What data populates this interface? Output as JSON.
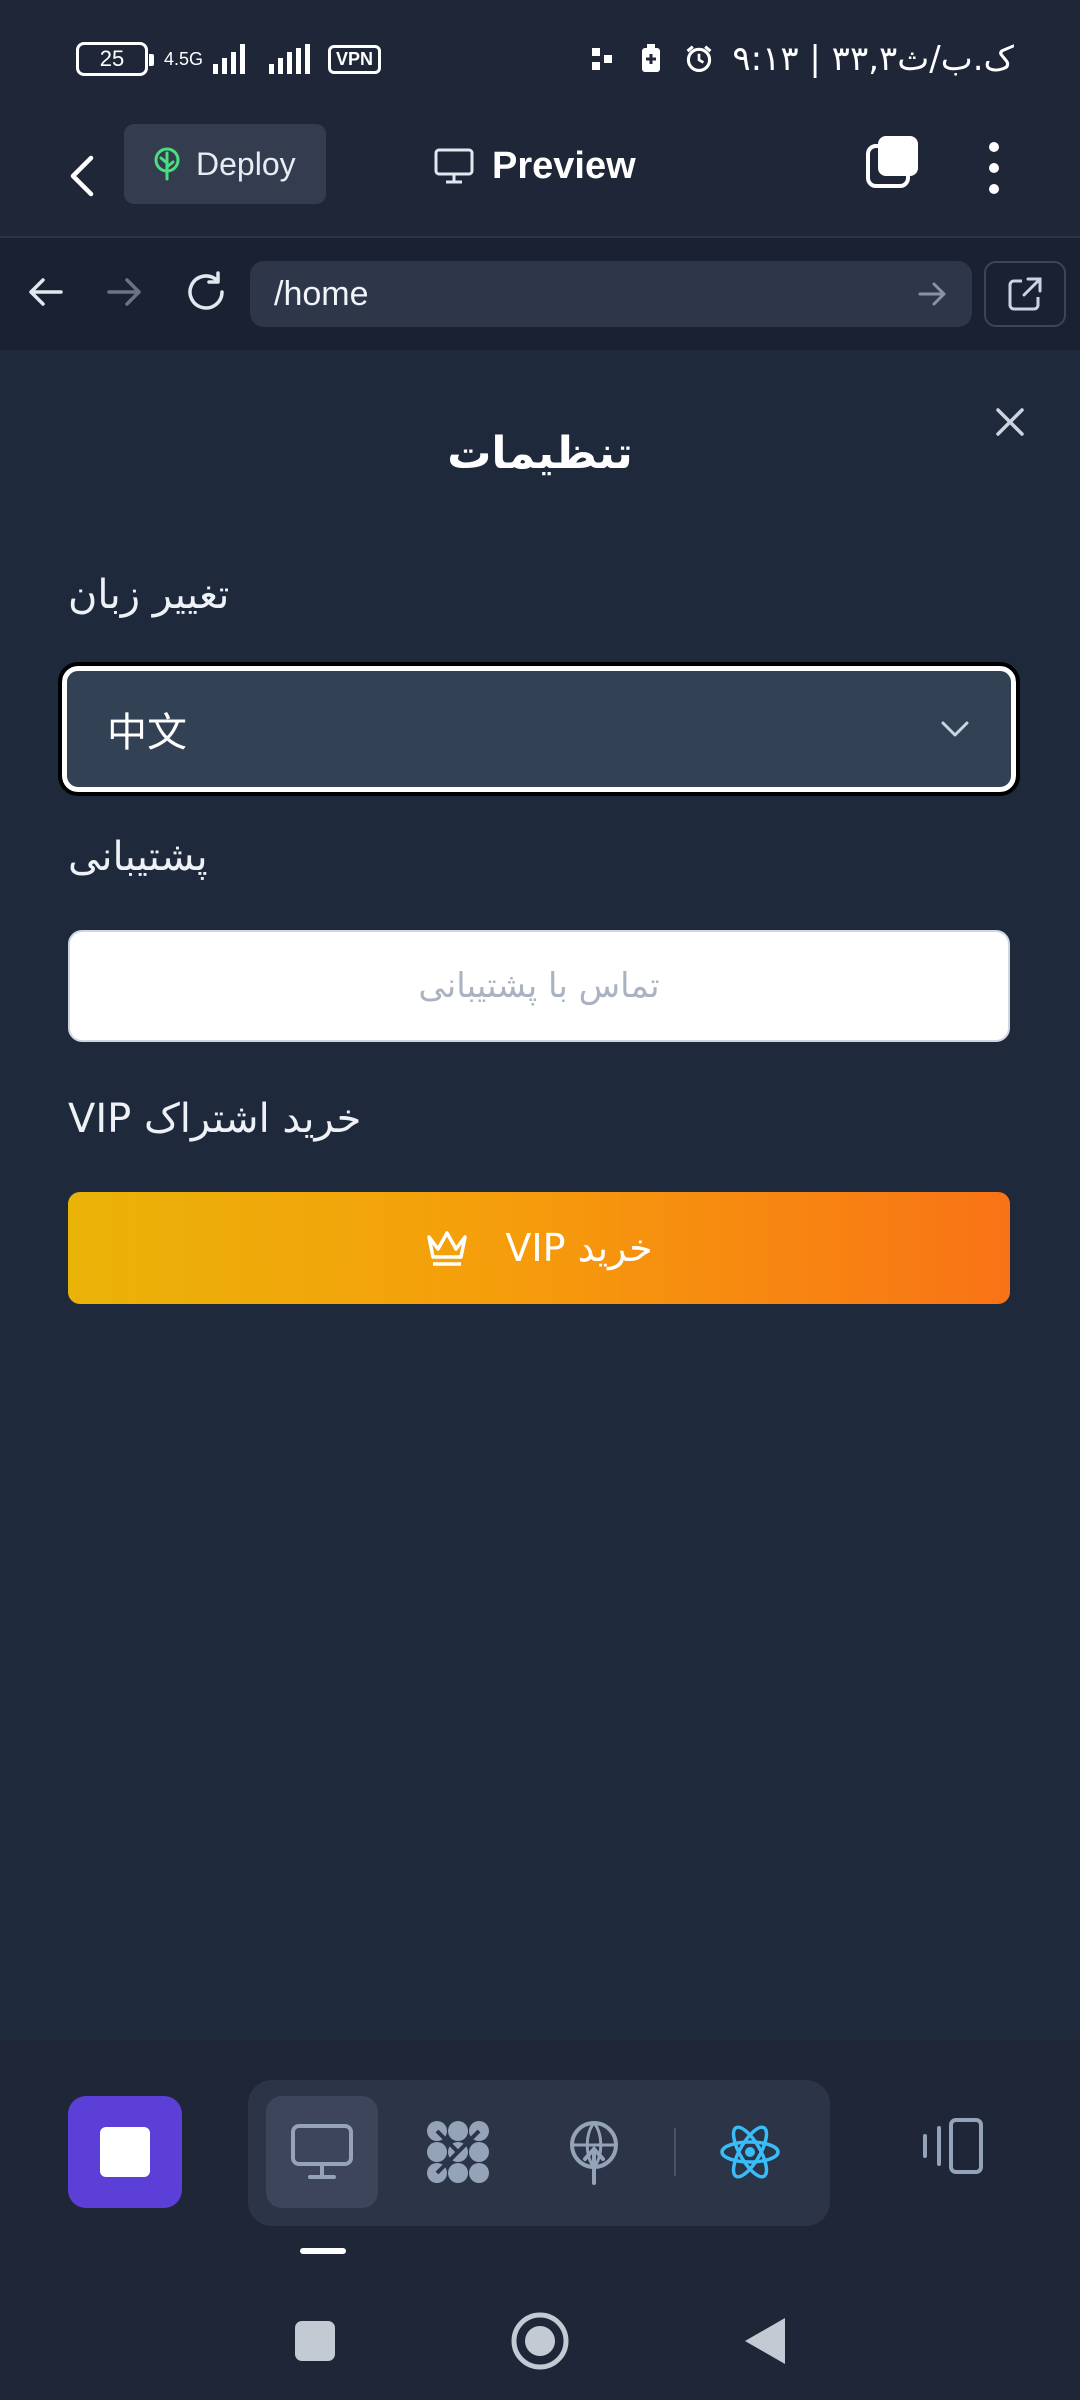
{
  "status_bar": {
    "battery": "25",
    "network": "4.5G",
    "vpn": "VPN",
    "time_text": "۹:۱۳ | ۳۳,۳ک.ب/ث"
  },
  "app_bar": {
    "deploy_label": "Deploy",
    "preview_label": "Preview"
  },
  "browser": {
    "url": "/home"
  },
  "settings": {
    "title": "تنظیمات",
    "language_label": "تغییر زبان",
    "language_value": "中文",
    "support_label": "پشتیبانی",
    "support_placeholder": "تماس با پشتیبانی",
    "vip_label": "خرید اشتراک VIP",
    "vip_button": "خرید VIP"
  },
  "colors": {
    "background": "#1e293b",
    "stop_button": "#5b3fd6",
    "vip_gradient_start": "#eab308",
    "vip_gradient_end": "#f97316",
    "react_icon": "#38bdf8"
  },
  "icons": [
    "back-icon",
    "deploy-tree-icon",
    "monitor-icon",
    "copy-icon",
    "more-icon",
    "arrow-left-icon",
    "arrow-right-icon",
    "reload-icon",
    "external-link-icon",
    "close-icon",
    "chevron-down-icon",
    "crown-icon",
    "desktop-icon",
    "network-icon",
    "antenna-icon",
    "react-icon",
    "panel-icon"
  ]
}
